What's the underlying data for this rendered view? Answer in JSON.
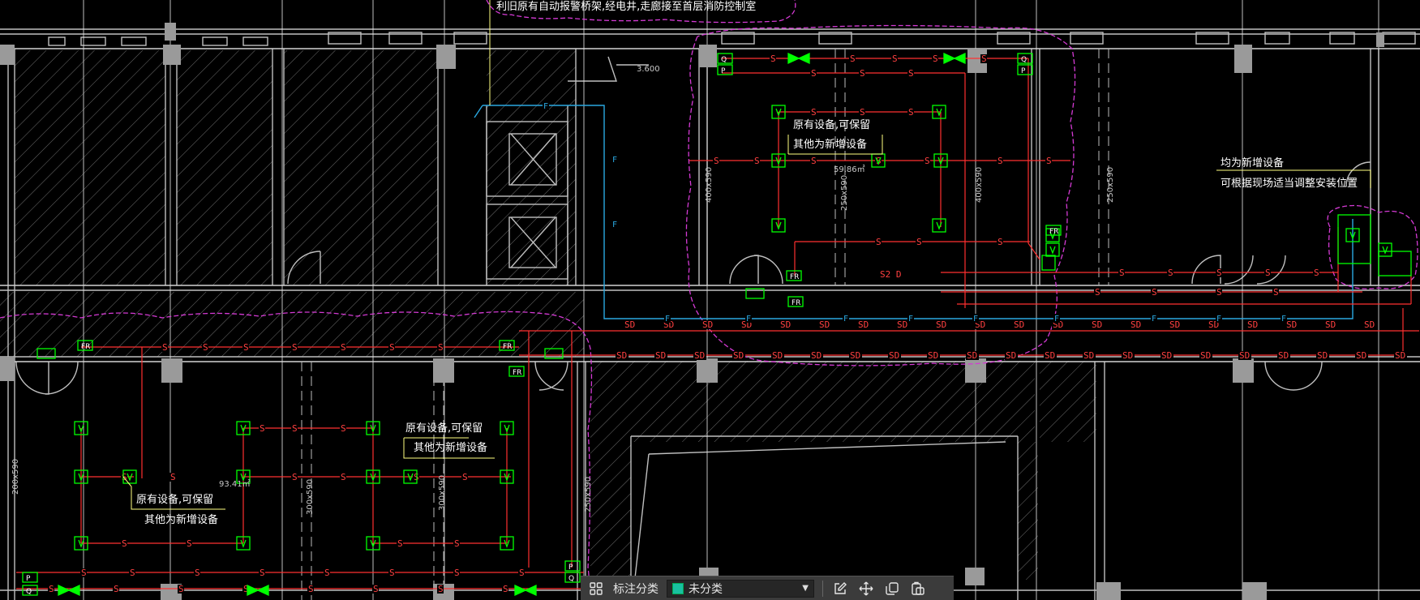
{
  "drawing": {
    "notes": {
      "top_note": "利旧原有自动报警桥架,经电井,走廊接至首层消防控制室",
      "keep_note_a": "原有设备,可保留",
      "new_note_a": "其他为新增设备",
      "keep_note_b": "原有设备,可保留",
      "new_note_b": "其他为新增设备",
      "keep_note_c": "原有设备,可保留",
      "new_note_c": "其他为新增设备",
      "new_all_note": "均为新增设备",
      "adjust_note": "可根据现场适当调整安装位置"
    },
    "dims": {
      "elev": "3.600",
      "area_a": "59.86㎡",
      "area_b": "93.41㎡",
      "dim_400x590": "400x590",
      "dim_250x590_a": "250x590",
      "dim_400x590_b": "400x590",
      "dim_250x590_b": "250x590",
      "dim_200x590": "200x590",
      "dim_300x590": "300x590",
      "dim_300x590_b": "300x590",
      "dim_250x590_c": "250x590",
      "s2d": "S2 D"
    },
    "line_labels": {
      "s": "S",
      "sd": "SD",
      "f": "F"
    },
    "devices": {
      "q": "Q",
      "p": "P",
      "fr": "FR"
    },
    "colors": {
      "background": "#000000",
      "wall": "#bfbfbf",
      "grid": "#d9d9d9",
      "hatch": "#8a8a8a",
      "smoke_wire": "#ff3030",
      "fire_bus": "#2aa8e0",
      "cloud": "#d43ad4",
      "device": "#00ff00",
      "annotation": "#ffff80"
    }
  },
  "toolbar": {
    "layers_icon": "layers-icon",
    "category_label": "标注分类",
    "category_value": "未分类",
    "category_swatch": "#19c0a0",
    "edit_icon": "edit-icon",
    "move_icon": "move-icon",
    "copy_icon": "copy-icon",
    "paste_icon": "paste-icon"
  }
}
